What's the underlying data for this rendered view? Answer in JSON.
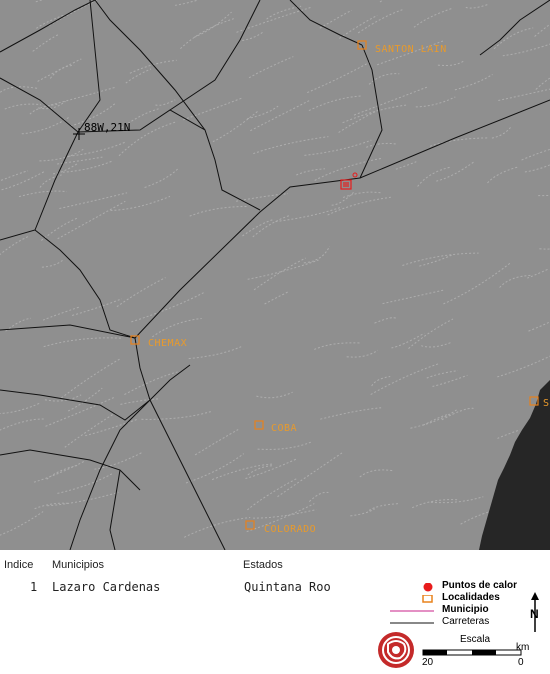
{
  "map": {
    "coordinate_label": "88W,21N",
    "localities": [
      {
        "name": "SANTON LAIN"
      },
      {
        "name": "CHEMAX"
      },
      {
        "name": "COBA"
      },
      {
        "name": "COLORADO"
      },
      {
        "name": "S"
      }
    ]
  },
  "table": {
    "headers": {
      "indice": "Indice",
      "municipios": "Municipios",
      "estados": "Estados"
    },
    "row": {
      "indice": "1",
      "municipio": "Lazaro Cardenas",
      "estado": "Quintana Roo"
    }
  },
  "legend": {
    "items": [
      {
        "label": "Puntos de calor",
        "color": "#e81c1c",
        "icon": "red-dot"
      },
      {
        "label": "Localidades",
        "color": "#e8821c",
        "icon": "orange-square"
      },
      {
        "label": "Municipio",
        "color": "#c8228a",
        "icon": "magenta-line"
      },
      {
        "label": "Carreteras",
        "color": "#111111",
        "icon": "black-line"
      }
    ],
    "scale_title": "Escala",
    "scale_unit": "km",
    "scale_left": "20",
    "scale_right": "0",
    "north_label": "N"
  },
  "colors": {
    "terrain": "#8f8f8f",
    "sea": "#2a2a2a",
    "contour": "#bdbdbd"
  }
}
